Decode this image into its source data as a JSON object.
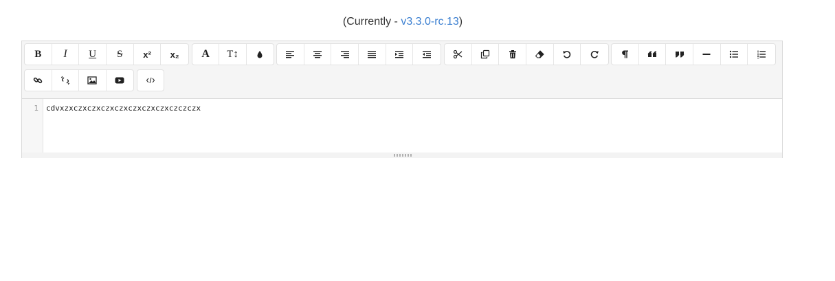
{
  "header": {
    "prefix": "(Currently - ",
    "version": "v3.3.0-rc.13",
    "suffix": ")",
    "link_color": "#3b7fd1"
  },
  "toolbar": {
    "groups": [
      [
        "bold-icon",
        "italic-icon",
        "underline-icon",
        "strikethrough-icon",
        "superscript-icon",
        "subscript-icon"
      ],
      [
        "font-color-icon",
        "font-size-icon",
        "highlight-icon"
      ],
      [
        "align-left-icon",
        "align-center-icon",
        "align-right-icon",
        "align-justify-icon",
        "indent-icon",
        "outdent-icon"
      ],
      [
        "cut-icon",
        "copy-icon",
        "delete-icon",
        "eraser-icon",
        "undo-icon",
        "redo-icon"
      ],
      [
        "paragraph-icon",
        "quote-left-icon",
        "quote-right-icon",
        "horizontal-rule-icon",
        "unordered-list-icon",
        "ordered-list-icon"
      ],
      [
        "link-icon",
        "unlink-icon",
        "image-icon",
        "youtube-icon"
      ],
      [
        "code-view-icon"
      ]
    ],
    "labels": {
      "bold": "B",
      "italic": "I",
      "underline": "U",
      "strike": "S",
      "sup": "x²",
      "sub": "x₂",
      "font": "A",
      "size": "T↕"
    }
  },
  "editor": {
    "line_number": "1",
    "content": "cdvxzxczxczxczxczxczxczxczxczczczx"
  }
}
